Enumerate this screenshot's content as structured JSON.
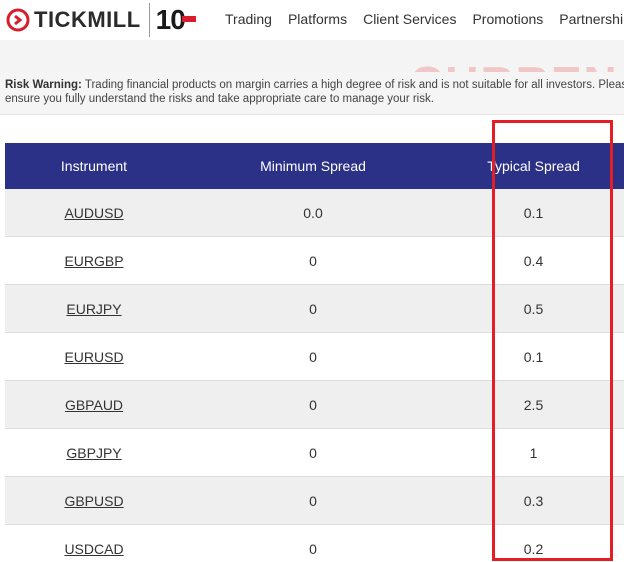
{
  "brand": {
    "name": "TICKMILL",
    "anniversary": "10",
    "accent_color": "#d81e2c"
  },
  "nav": {
    "items": [
      {
        "label": "Trading"
      },
      {
        "label": "Platforms"
      },
      {
        "label": "Client Services"
      },
      {
        "label": "Promotions"
      },
      {
        "label": "Partnerships"
      }
    ]
  },
  "banner": {
    "ghost_text": "CURRENC"
  },
  "risk_warning": {
    "label": "Risk Warning:",
    "text": " Trading financial products on margin carries a high degree of risk and is not suitable for all investors. Please ensure you fully understand the risks and take appropriate care to manage your risk."
  },
  "table": {
    "header_color": "#2b3186",
    "columns": {
      "instrument": "Instrument",
      "minimum_spread": "Minimum Spread",
      "typical_spread": "Typical Spread"
    },
    "rows": [
      {
        "instrument": "AUDUSD",
        "minimum_spread": "0.0",
        "typical_spread": "0.1"
      },
      {
        "instrument": "EURGBP",
        "minimum_spread": "0",
        "typical_spread": "0.4"
      },
      {
        "instrument": "EURJPY",
        "minimum_spread": "0",
        "typical_spread": "0.5"
      },
      {
        "instrument": "EURUSD",
        "minimum_spread": "0",
        "typical_spread": "0.1"
      },
      {
        "instrument": "GBPAUD",
        "minimum_spread": "0",
        "typical_spread": "2.5"
      },
      {
        "instrument": "GBPJPY",
        "minimum_spread": "0",
        "typical_spread": "1"
      },
      {
        "instrument": "GBPUSD",
        "minimum_spread": "0",
        "typical_spread": "0.3"
      },
      {
        "instrument": "USDCAD",
        "minimum_spread": "0",
        "typical_spread": "0.2"
      }
    ]
  },
  "highlight": {
    "color": "#e31e24",
    "target": "typical_spread"
  }
}
